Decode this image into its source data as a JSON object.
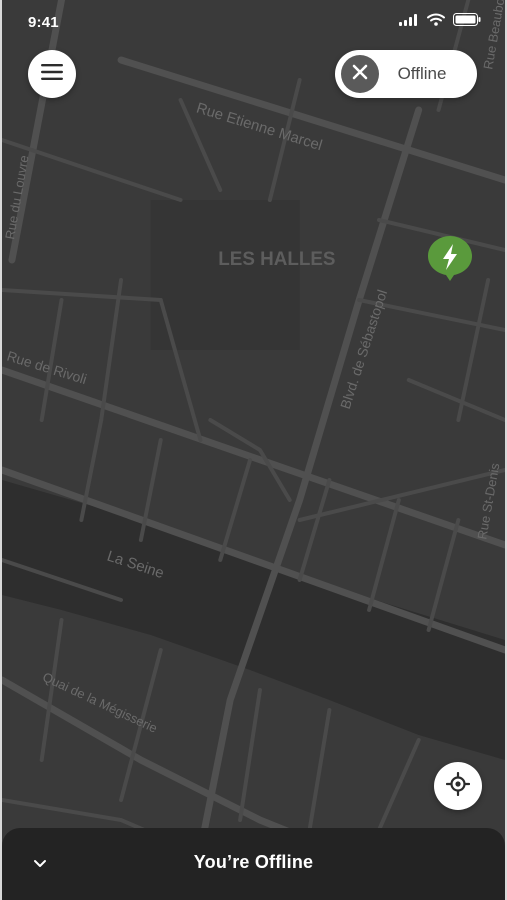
{
  "status_bar": {
    "time": "9:41",
    "icons": [
      "cellular-signal-icon",
      "wifi-icon",
      "battery-icon"
    ]
  },
  "header": {
    "menu_icon": "hamburger-menu-icon",
    "toggle": {
      "icon": "close-icon",
      "label": "Offline"
    }
  },
  "map": {
    "labels": {
      "rue_etienne_marcel": "Rue Etienne Marcel",
      "les_halles": "LES HALLES",
      "blvd_sebastopol": "Blvd. de Sébastopol",
      "rue_rivoli": "Rue de Rivoli",
      "la_seine": "La Seine",
      "quai_louvre": "Rue du Louvre",
      "quai_megisserie": "Quai de la Mégisserie",
      "rue_st_denis": "Rue St-Denis",
      "rue_beaubourg": "Rue Beaubourg"
    },
    "charger_pin_icon": "lightning-bolt-icon",
    "colors": {
      "background": "#3a3a3a",
      "road": "#4e4e4e",
      "water": "#2e2e2e",
      "pin": "#5a9a3c"
    }
  },
  "locate_button": {
    "icon": "crosshair-locate-icon"
  },
  "bottom_sheet": {
    "chevron_icon": "chevron-down-icon",
    "title": "You’re Offline"
  }
}
